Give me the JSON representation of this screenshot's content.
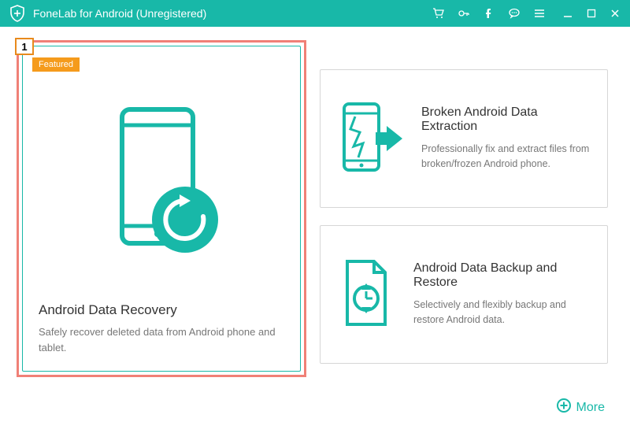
{
  "titlebar": {
    "app_title": "FoneLab for Android (Unregistered)"
  },
  "annotation": {
    "step1": "1"
  },
  "main_card": {
    "featured_label": "Featured",
    "title": "Android Data Recovery",
    "desc": "Safely recover deleted data from Android phone and tablet."
  },
  "card_extraction": {
    "title": "Broken Android Data Extraction",
    "desc": "Professionally fix and extract files from broken/frozen Android phone."
  },
  "card_backup": {
    "title": "Android Data Backup and Restore",
    "desc": "Selectively and flexibly backup and restore Android data."
  },
  "footer": {
    "more_label": "More"
  }
}
